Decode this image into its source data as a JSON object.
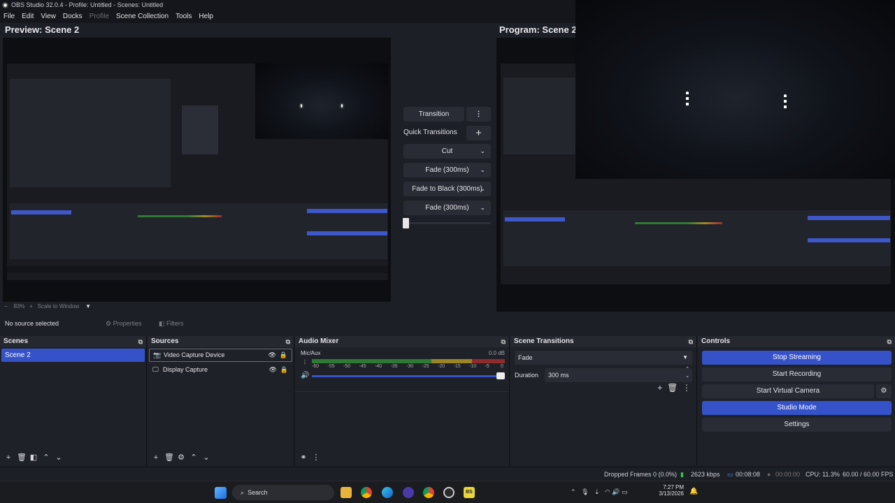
{
  "window": {
    "title": "OBS Studio 32.0.4 - Profile: Untitled - Scenes: Untitled"
  },
  "menu": [
    "File",
    "Edit",
    "View",
    "Docks",
    "Profile",
    "Scene Collection",
    "Tools",
    "Help"
  ],
  "preview": {
    "title": "Preview: Scene 2",
    "zoom": "83%",
    "scale_mode": "Scale to Window"
  },
  "program": {
    "title": "Program: Scene 2"
  },
  "transition": {
    "button": "Transition",
    "quick_label": "Quick Transitions",
    "items": [
      "Cut",
      "Fade (300ms)",
      "Fade to Black (300ms)",
      "Fade (300ms)"
    ]
  },
  "context": {
    "no_source": "No source selected",
    "properties": "Properties",
    "filters": "Filters"
  },
  "scenes": {
    "title": "Scenes",
    "items": [
      "Scene 2"
    ]
  },
  "sources": {
    "title": "Sources",
    "items": [
      "Video Capture Device",
      "Display Capture"
    ]
  },
  "mixer": {
    "title": "Audio Mixer",
    "channel": "Mic/Aux",
    "db": "0.0 dB",
    "ticks": [
      "-60",
      "-55",
      "-50",
      "-45",
      "-40",
      "-35",
      "-30",
      "-25",
      "-20",
      "-15",
      "-10",
      "-5",
      "0"
    ],
    "volume_level": 1.0
  },
  "scene_transitions": {
    "title": "Scene Transitions",
    "type": "Fade",
    "duration_label": "Duration",
    "duration": "300 ms"
  },
  "controls": {
    "title": "Controls",
    "stop_streaming": "Stop Streaming",
    "start_recording": "Start Recording",
    "start_virtual_camera": "Start Virtual Camera",
    "studio_mode": "Studio Mode",
    "settings": "Settings"
  },
  "status": {
    "dropped": "Dropped Frames 0 (0.0%)",
    "kbps": "2623 kbps",
    "stream_time": "00:08:08",
    "rec_time": "00:00:00",
    "cpu": "CPU: 11.3%",
    "fps": "60.00 / 60.00 FPS"
  },
  "taskbar": {
    "search": "Search",
    "time": "7:27 PM",
    "date": "3/13/2026"
  },
  "colors": {
    "accent": "#3552c8",
    "panel": "#1f2128",
    "bg": "#1d1f26"
  }
}
